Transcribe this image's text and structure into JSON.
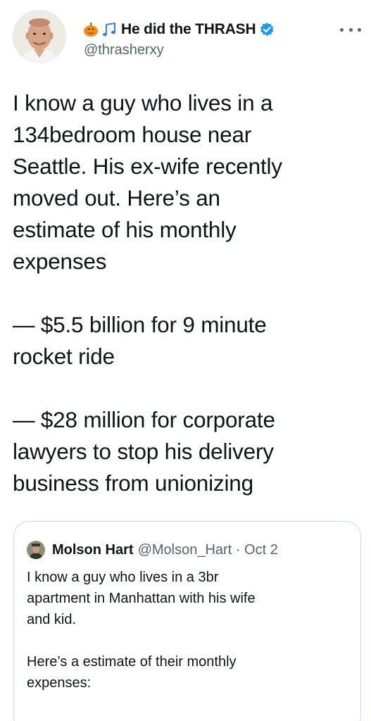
{
  "author": {
    "display_name": "He did the THRASH",
    "handle": "@thrasherxy",
    "emoji_names": [
      "pumpkin-icon",
      "music-notes-icon"
    ],
    "verified": true
  },
  "tweet_lines": [
    "I know a guy who lives in a",
    "134bedroom house near",
    "Seattle. His ex-wife recently",
    "moved out. Here’s an",
    "estimate of his monthly",
    "expenses",
    "",
    "— $5.5 billion for 9 minute",
    "rocket ride",
    "",
    "— $28 million for corporate",
    "lawyers to stop his delivery",
    "business from unionizing"
  ],
  "quoted": {
    "display_name": "Molson Hart",
    "handle_date": "@Molson_Hart · Oct 2",
    "lines": [
      "I know a guy who lives in a 3br",
      "apartment in Manhattan with his wife",
      "and kid.",
      "",
      "Here’s a estimate of their monthly",
      "expenses:"
    ]
  },
  "colors": {
    "text": "#0f1419",
    "secondary": "#536471",
    "verified_blue": "#1d9bf0",
    "border": "#cfd9de"
  }
}
